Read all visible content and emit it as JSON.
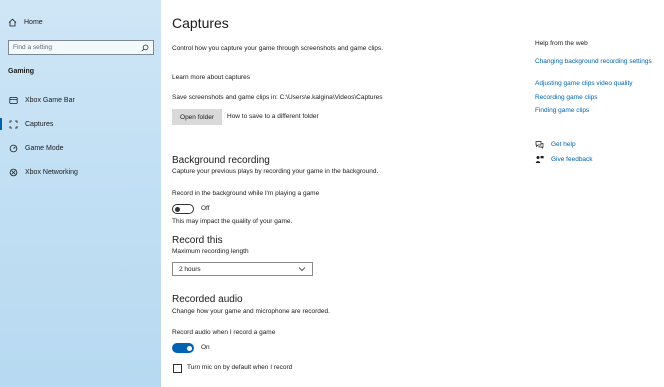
{
  "sidebar": {
    "home_label": "Home",
    "search_placeholder": "Find a setting",
    "section_title": "Gaming",
    "items": [
      {
        "label": "Xbox Game Bar",
        "icon": "game-bar-icon"
      },
      {
        "label": "Captures",
        "icon": "captures-icon",
        "active": true
      },
      {
        "label": "Game Mode",
        "icon": "game-mode-icon"
      },
      {
        "label": "Xbox Networking",
        "icon": "xbox-icon"
      }
    ]
  },
  "main": {
    "title": "Captures",
    "description": "Control how you capture your game through screenshots and game clips.",
    "learn_more": "Learn more about captures",
    "save_path_text": "Save screenshots and game clips in: C:\\Users\\e.kalgina\\Videos\\Captures",
    "open_folder_button": "Open folder",
    "different_folder_link": "How to save to a different folder",
    "background_recording": {
      "heading": "Background recording",
      "subtitle": "Capture your previous plays by recording your game in the background.",
      "toggle_label": "Record in the background while I'm playing a game",
      "toggle_state": "Off",
      "note": "This may impact the quality of your game."
    },
    "record_this": {
      "heading": "Record this",
      "max_length_label": "Maximum recording length",
      "max_length_value": "2 hours"
    },
    "recorded_audio": {
      "heading": "Recorded audio",
      "subtitle": "Change how your game and microphone are recorded.",
      "toggle_label": "Record audio when I record a game",
      "toggle_state": "On",
      "checkbox_label": "Turn mic on by default when I record"
    }
  },
  "help": {
    "title": "Help from the web",
    "links": [
      "Changing background recording settings",
      "Adjusting game clips video quality",
      "Recording game clips",
      "Finding game clips"
    ],
    "get_help": "Get help",
    "give_feedback": "Give feedback"
  },
  "colors": {
    "accent": "#0063b1",
    "sidebar_bg": "#c3e0f4"
  }
}
